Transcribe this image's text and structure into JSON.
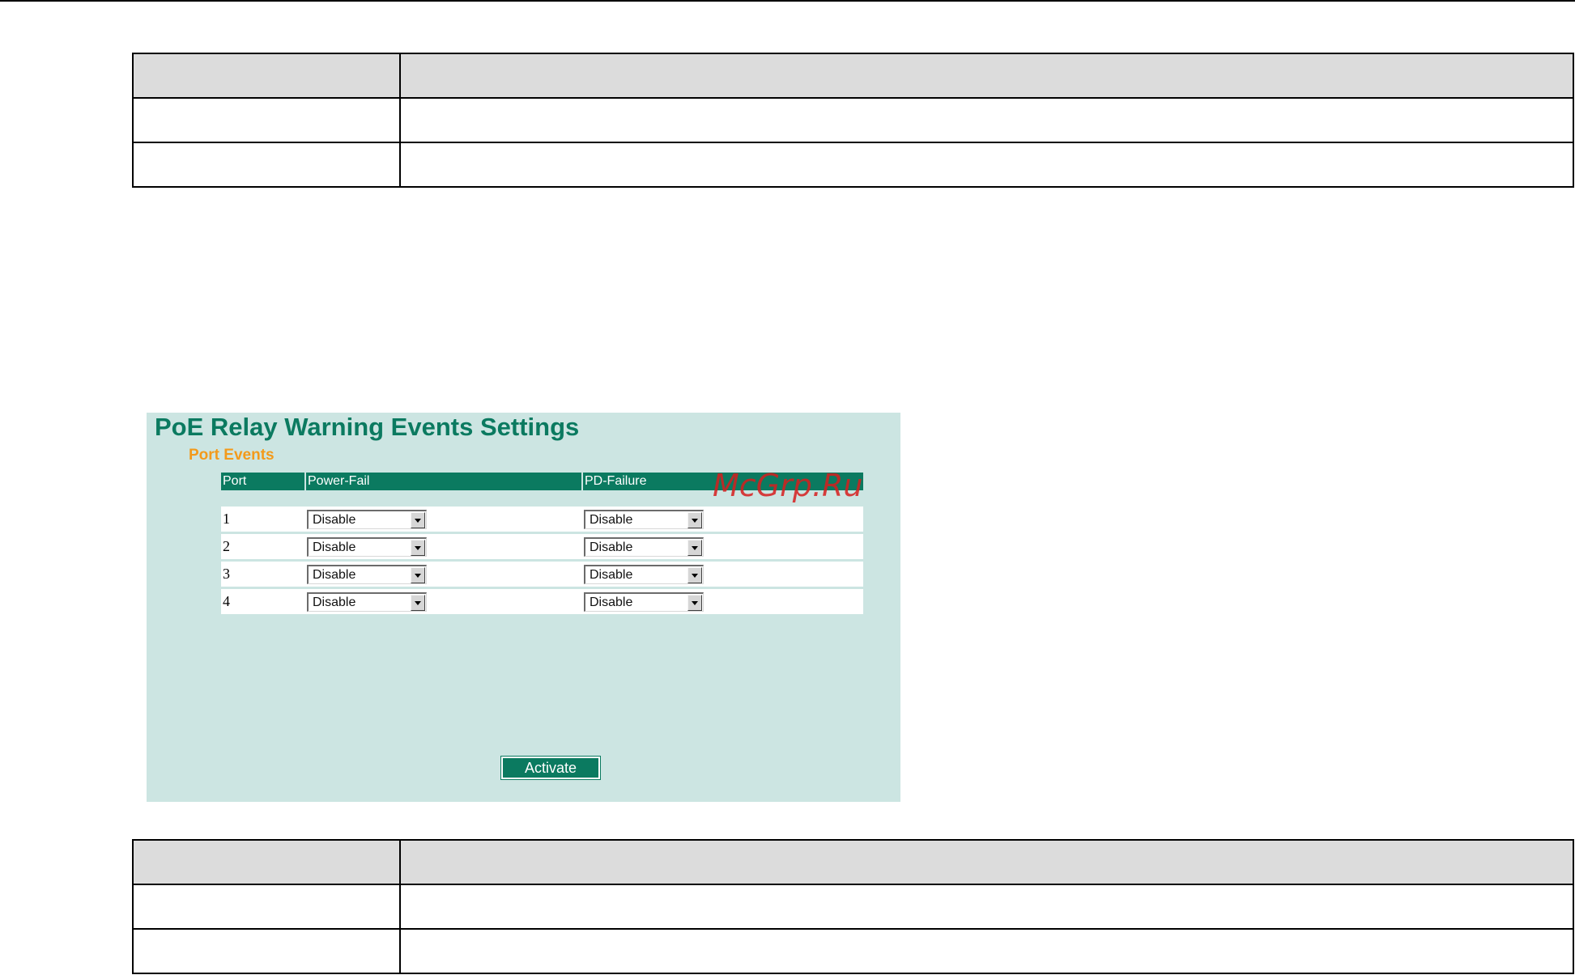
{
  "panel": {
    "title": "PoE Relay Warning Events Settings",
    "section_title": "Port Events",
    "columns": [
      "Port",
      "Power-Fail",
      "PD-Failure"
    ],
    "rows": [
      {
        "port": "1",
        "power_fail": "Disable",
        "pd_failure": "Disable"
      },
      {
        "port": "2",
        "power_fail": "Disable",
        "pd_failure": "Disable"
      },
      {
        "port": "3",
        "power_fail": "Disable",
        "pd_failure": "Disable"
      },
      {
        "port": "4",
        "power_fail": "Disable",
        "pd_failure": "Disable"
      }
    ],
    "activate_label": "Activate"
  },
  "watermark": "McGrp.Ru",
  "colors": {
    "panel_bg": "#cce5e2",
    "accent_green": "#0b7a60",
    "section_orange": "#f39a1b",
    "watermark_red": "#d71e1e"
  },
  "icons": {
    "dropdown": "chevron-down-icon"
  }
}
